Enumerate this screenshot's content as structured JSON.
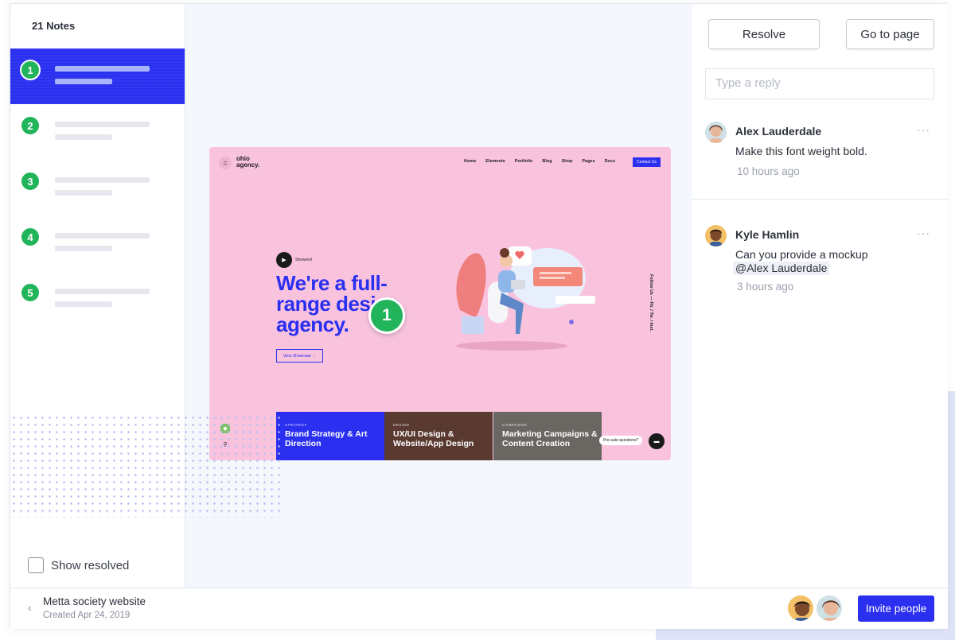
{
  "sidebar": {
    "notes_count": "21 Notes",
    "notes": [
      {
        "num": "1",
        "active": true
      },
      {
        "num": "2",
        "active": false
      },
      {
        "num": "3",
        "active": false
      },
      {
        "num": "4",
        "active": false
      },
      {
        "num": "5",
        "active": false
      }
    ],
    "show_resolved_label": "Show resolved"
  },
  "canvas": {
    "pin_number": "1",
    "mockup": {
      "logo": "ohio agency.",
      "nav": [
        "Home",
        "Elements",
        "Portfolio",
        "Blog",
        "Shop",
        "Pages",
        "Docs"
      ],
      "cta": "Contact Us",
      "showreel": "Showreel",
      "headline": "We're a full-range design agency.",
      "view_button": "View Showcase →",
      "side_text": "Follow Us — Fb. / Tw. / Inst.",
      "cards": [
        {
          "category": "STRATEGY",
          "title": "Brand Strategy & Art Direction"
        },
        {
          "category": "DESIGN",
          "title": "UX/UI Design & Website/App Design"
        },
        {
          "category": "CAMPAIGNS",
          "title": "Marketing Campaigns & Content Creation"
        }
      ],
      "chat_bubble": "Pre-sale questions?"
    }
  },
  "panel": {
    "resolve_label": "Resolve",
    "goto_label": "Go to page",
    "reply_placeholder": "Type a reply",
    "comments": [
      {
        "author": "Alex Lauderdale",
        "text": "Make this font weight bold.",
        "mention": "",
        "time": "10 hours ago"
      },
      {
        "author": "Kyle Hamlin",
        "text": "Can you provide a mockup",
        "mention": "@Alex Lauderdale",
        "time": "3 hours ago"
      }
    ],
    "more_icon": "···"
  },
  "footer": {
    "back_icon": "‹",
    "project_name": "Metta society website",
    "project_created": "Created Apr 24, 2019",
    "invite_label": "Invite people"
  },
  "colors": {
    "accent": "#2a2ff0",
    "note_green": "#22b45a",
    "mock_pink": "#f9c3de"
  }
}
